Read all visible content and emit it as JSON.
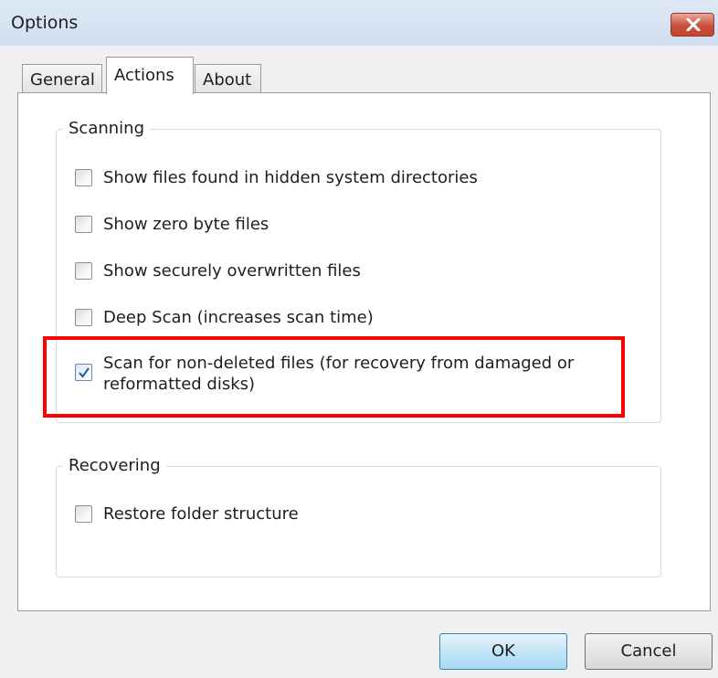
{
  "window": {
    "title": "Options",
    "close_icon": "close-icon"
  },
  "tabs": [
    {
      "label": "General",
      "active": false
    },
    {
      "label": "Actions",
      "active": true
    },
    {
      "label": "About",
      "active": false
    }
  ],
  "scanning": {
    "label": "Scanning",
    "options": [
      {
        "label": "Show files found in hidden system directories",
        "checked": false
      },
      {
        "label": "Show zero byte files",
        "checked": false
      },
      {
        "label": "Show securely overwritten files",
        "checked": false
      },
      {
        "label": "Deep Scan (increases scan time)",
        "checked": false
      },
      {
        "label": "Scan for non-deleted files (for recovery from damaged or reformatted disks)",
        "checked": true
      }
    ]
  },
  "recovering": {
    "label": "Recovering",
    "options": [
      {
        "label": "Restore folder structure",
        "checked": false
      }
    ]
  },
  "buttons": {
    "ok_label": "OK",
    "cancel_label": "Cancel"
  },
  "colors": {
    "highlight": "#ff0000",
    "close_button": "#c9503a"
  }
}
